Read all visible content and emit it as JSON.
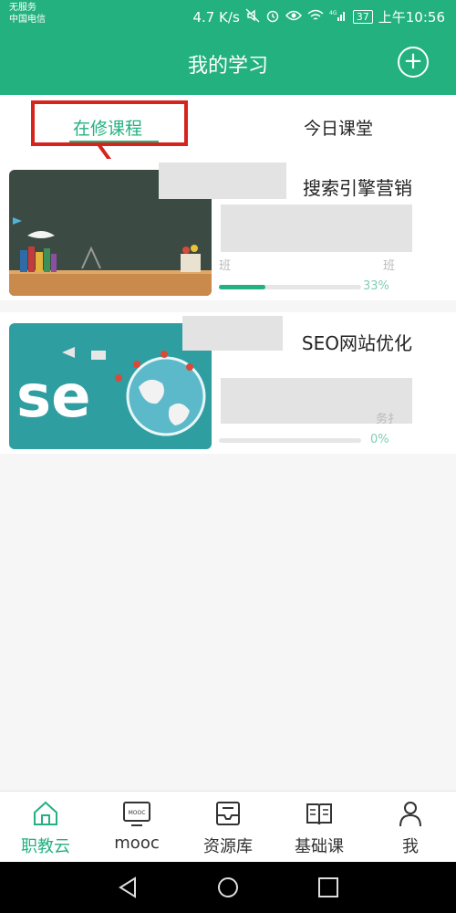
{
  "status_bar": {
    "service_text": "无服务",
    "carrier": "中国电信",
    "network_speed": "4.7 K/s",
    "battery": "37",
    "time": "上午10:56",
    "signal_label": "4G"
  },
  "header": {
    "title": "我的学习",
    "add_icon": "plus-circle-icon"
  },
  "tabs": [
    {
      "label": "在修课程",
      "active": true
    },
    {
      "label": "今日课堂",
      "active": false
    }
  ],
  "courses": [
    {
      "title": "搜索引擎营销",
      "subtitle_left": "班",
      "subtitle_right": "班",
      "progress_text": "33%",
      "progress": 0.33,
      "thumbnail": "chalkboard-desk-illustration"
    },
    {
      "title": "SEO网站优化",
      "subtitle_right": "务扌",
      "progress_text": "0%",
      "progress": 0,
      "thumbnail": "seo-globe-illustration"
    }
  ],
  "bottom_nav": [
    {
      "label": "职教云",
      "icon": "home-icon",
      "active": true
    },
    {
      "label": "mooc",
      "icon": "mooc-monitor-icon",
      "active": false,
      "icon_text": "MOOC"
    },
    {
      "label": "资源库",
      "icon": "inbox-tray-icon",
      "active": false
    },
    {
      "label": "基础课",
      "icon": "open-book-icon",
      "active": false
    },
    {
      "label": "我",
      "icon": "person-icon",
      "active": false
    }
  ],
  "colors": {
    "brand": "#23b27f",
    "annotation": "#d6241d"
  }
}
